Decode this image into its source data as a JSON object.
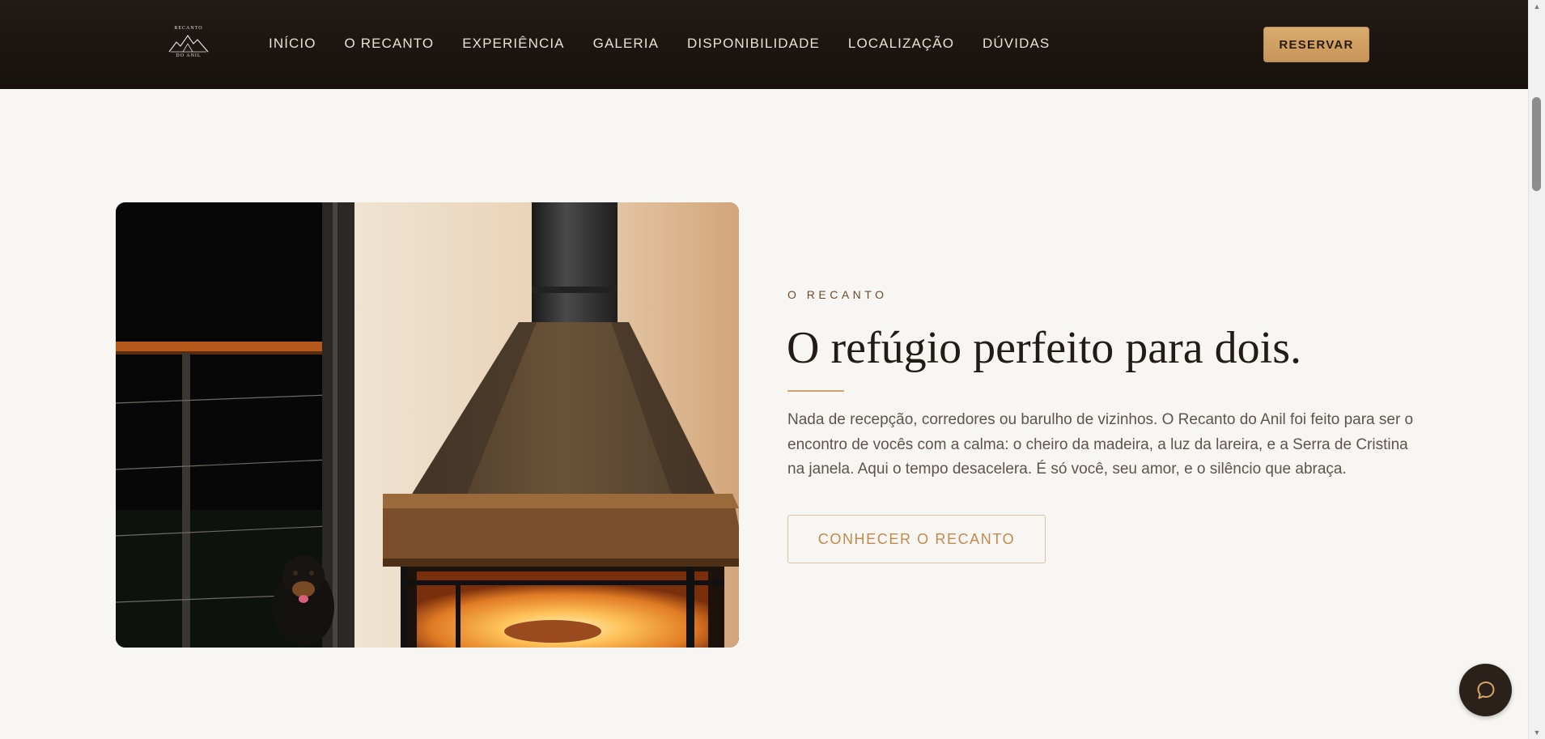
{
  "header": {
    "logo": {
      "line_top": "RECANTO",
      "line_bottom": "DO ANIL"
    },
    "nav": [
      {
        "label": "INÍCIO"
      },
      {
        "label": "O RECANTO"
      },
      {
        "label": "EXPERIÊNCIA"
      },
      {
        "label": "GALERIA"
      },
      {
        "label": "DISPONIBILIDADE"
      },
      {
        "label": "LOCALIZAÇÃO"
      },
      {
        "label": "DÚVIDAS"
      }
    ],
    "reserve_label": "RESERVAR"
  },
  "section": {
    "eyebrow": "O RECANTO",
    "headline": "O refúgio perfeito para dois.",
    "body": "Nada de recepção, corredores ou barulho de vizinhos. O Recanto do Anil foi feito para ser o encontro de vocês com a calma: o cheiro da madeira, a luz da lareira, e a Serra de Cristina na janela. Aqui o tempo desacelera. É só você, seu amor, e o silêncio que abraça.",
    "cta_label": "CONHECER O RECANTO"
  },
  "colors": {
    "header_bg": "#1c1510",
    "accent_gold": "#d3a265",
    "page_bg": "#f8f6f2",
    "chat_bg": "#2a211b"
  },
  "icons": {
    "chat": "chat-bubble-icon",
    "logo": "mountain-logo-icon"
  }
}
